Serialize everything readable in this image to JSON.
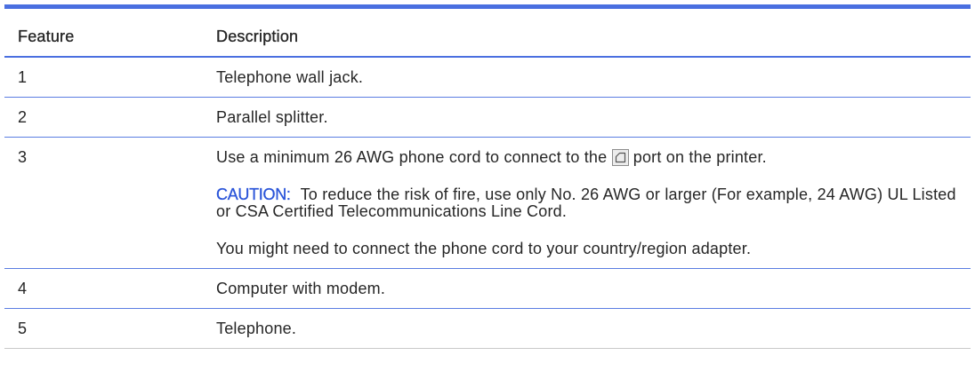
{
  "table": {
    "headers": {
      "feature": "Feature",
      "description": "Description"
    },
    "rows": [
      {
        "feature": "1",
        "description": "Telephone wall jack."
      },
      {
        "feature": "2",
        "description": "Parallel splitter."
      },
      {
        "feature": "3",
        "description_before_icon": "Use a minimum 26 AWG phone cord to connect to the",
        "port_icon": "phone-port-icon",
        "description_after_icon": "port on the printer.",
        "caution_label": "CAUTION:",
        "caution_text": "To reduce the risk of fire, use only No. 26 AWG or larger (For example, 24 AWG) UL Listed or CSA Certified Telecommunications Line Cord.",
        "note": "You might need to connect the phone cord to your country/region adapter."
      },
      {
        "feature": "4",
        "description": "Computer with modem."
      },
      {
        "feature": "5",
        "description": "Telephone."
      }
    ]
  },
  "colors": {
    "accent": "#4a6fe0",
    "rule": "#5b7de2",
    "caution": "#2b55d9",
    "text": "#262626",
    "last_rule": "#c9c9c9"
  }
}
